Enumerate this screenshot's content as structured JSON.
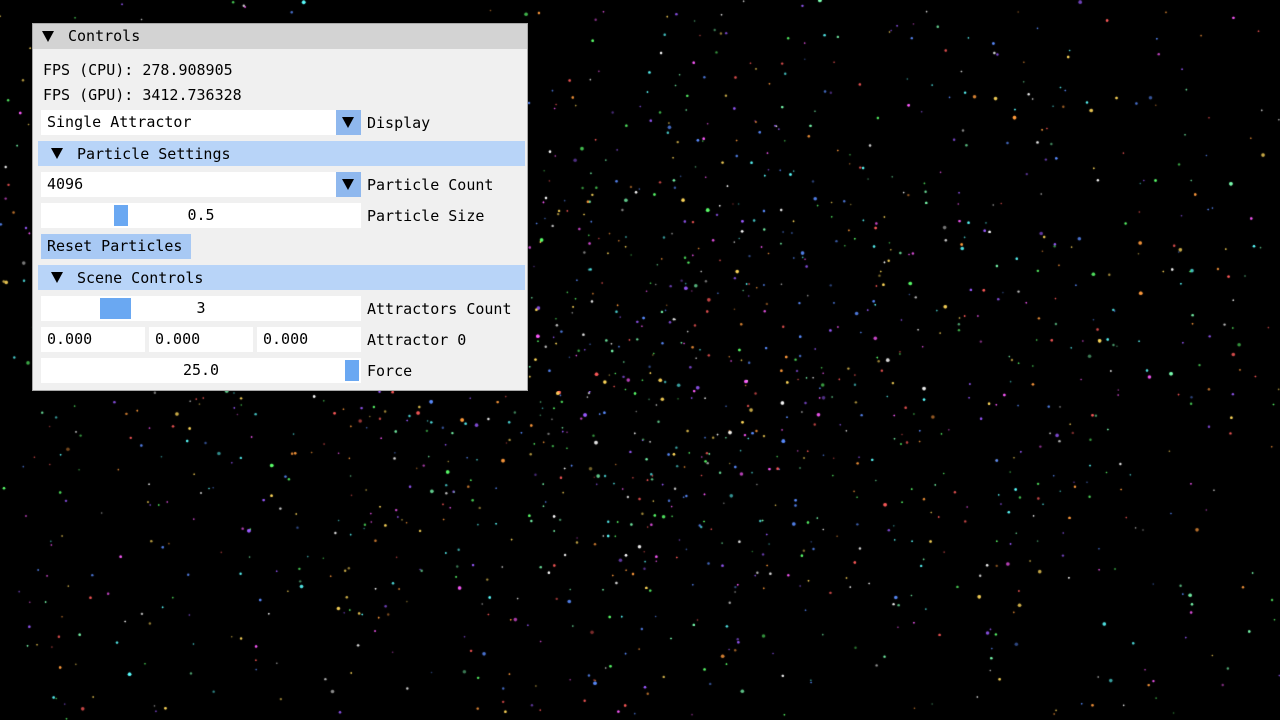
{
  "panel": {
    "title": "Controls",
    "fps_cpu": "FPS (CPU): 278.908905",
    "fps_gpu": "FPS (GPU): 3412.736328"
  },
  "display": {
    "value": "Single Attractor",
    "label": "Display"
  },
  "particle_settings": {
    "header": "Particle Settings",
    "count_value": "4096",
    "count_label": "Particle Count",
    "size_value": "0.5",
    "size_label": "Particle Size",
    "size_fraction": 0.235,
    "reset_label": "Reset Particles"
  },
  "scene_controls": {
    "header": "Scene Controls",
    "attractors_count_value": "3",
    "attractors_count_label": "Attractors Count",
    "attractors_count_fraction": 0.2,
    "attractor_x": "0.000",
    "attractor_y": "0.000",
    "attractor_z": "0.000",
    "attractor_label": "Attractor 0",
    "force_value": "25.0",
    "force_label": "Force",
    "force_fraction": 1.0
  },
  "colors": {
    "background": "#000000",
    "panel_bg": "#f0f0f0",
    "title_bar": "#d3d3d3",
    "section_header": "#b8d4f8",
    "slider_grab": "#6aa8f2",
    "button": "#a8c9f4",
    "particle_palette": [
      "#ff5a5a",
      "#5aff6a",
      "#5a8cff",
      "#ff5aff",
      "#5affff",
      "#ffd85a",
      "#ffffff",
      "#ff9a3c",
      "#9a5aff",
      "#7affb0"
    ]
  },
  "icons": {
    "collapse": "triangle-down-icon",
    "combo_arrow": "triangle-down-icon"
  }
}
